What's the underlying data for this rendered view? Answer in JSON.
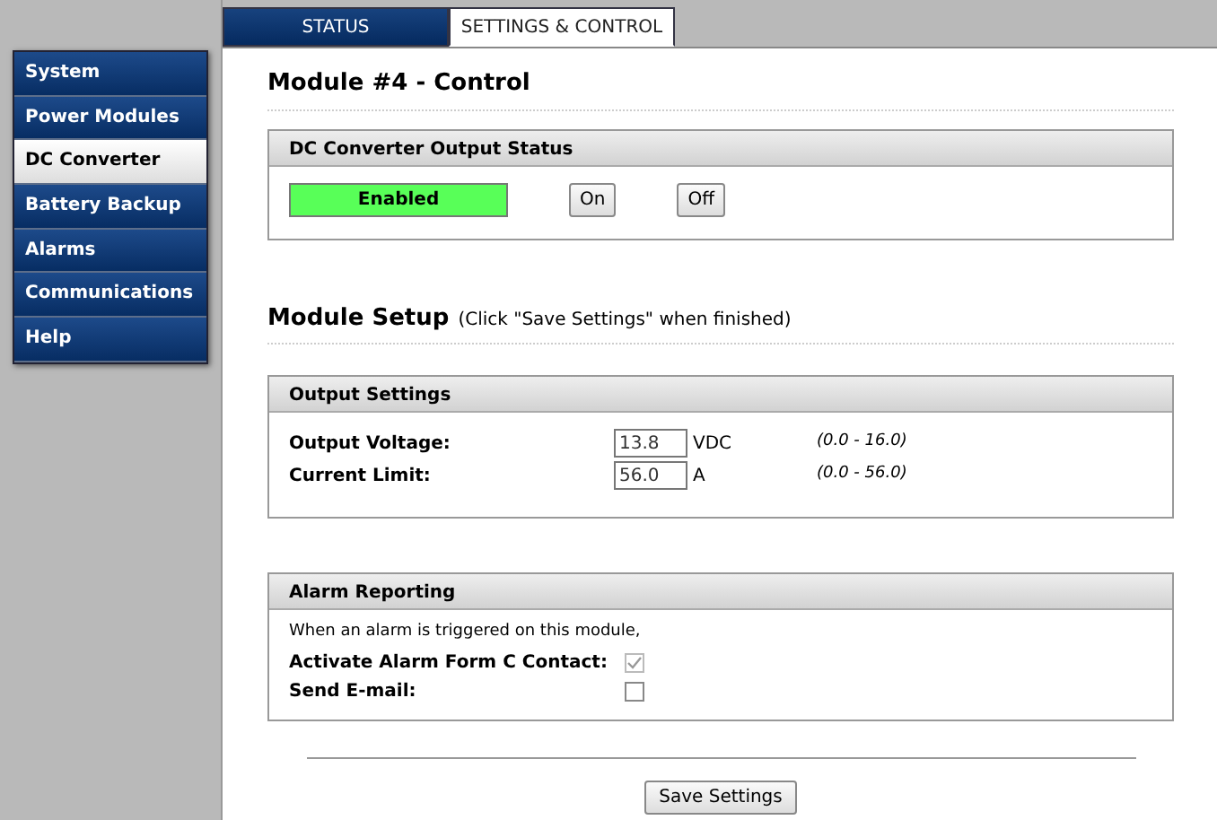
{
  "tabs": [
    {
      "label": "STATUS",
      "selected": false
    },
    {
      "label": "SETTINGS & CONTROL",
      "selected": true
    }
  ],
  "sidebar": {
    "items": [
      {
        "label": "System",
        "selected": false
      },
      {
        "label": "Power Modules",
        "selected": false
      },
      {
        "label": "DC Converter",
        "selected": true
      },
      {
        "label": "Battery Backup",
        "selected": false
      },
      {
        "label": "Alarms",
        "selected": false
      },
      {
        "label": "Communications",
        "selected": false
      },
      {
        "label": "Help",
        "selected": false
      }
    ]
  },
  "page_title": "Module #4 - Control",
  "status_panel": {
    "title": "DC Converter Output Status",
    "status": {
      "text": "Enabled",
      "on": true
    },
    "buttons": [
      "On",
      "Off"
    ]
  },
  "setup": {
    "title": "Module Setup",
    "hint": "(Click \"Save Settings\" when finished)"
  },
  "output_settings": {
    "title": "Output Settings",
    "rows": [
      {
        "label": "Output Voltage:",
        "value": "13.8",
        "unit": "VDC",
        "range": "(0.0 - 16.0)"
      },
      {
        "label": "Current Limit:",
        "value": "56.0",
        "unit": "A",
        "range": "(0.0 - 56.0)"
      }
    ]
  },
  "alarm_reporting": {
    "title": "Alarm Reporting",
    "intro": "When an alarm is triggered on this module,",
    "rows": [
      {
        "label": "Activate Alarm Form C Contact:",
        "checked": true,
        "disabled": true
      },
      {
        "label": "Send E-mail:",
        "checked": false,
        "disabled": false
      }
    ]
  },
  "save_button": "Save Settings"
}
